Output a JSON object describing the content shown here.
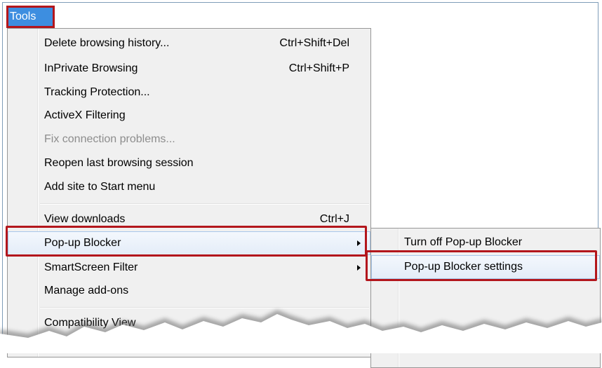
{
  "menubar": {
    "tools_label": "Tools"
  },
  "tools_menu": {
    "items": [
      {
        "label": "Delete browsing history...",
        "shortcut": "Ctrl+Shift+Del"
      },
      {
        "label": "InPrivate Browsing",
        "shortcut": "Ctrl+Shift+P"
      },
      {
        "label": "Tracking Protection..."
      },
      {
        "label": "ActiveX Filtering"
      },
      {
        "label": "Fix connection problems...",
        "disabled": true
      },
      {
        "label": "Reopen last browsing session"
      },
      {
        "label": "Add site to Start menu"
      },
      {
        "label": "View downloads",
        "shortcut": "Ctrl+J"
      },
      {
        "label": "Pop-up Blocker",
        "submenu": true,
        "highlighted": true
      },
      {
        "label": "SmartScreen Filter",
        "submenu": true
      },
      {
        "label": "Manage add-ons"
      },
      {
        "label": "Compatibility View"
      }
    ]
  },
  "popup_submenu": {
    "items": [
      {
        "label": "Turn off Pop-up Blocker"
      },
      {
        "label": "Pop-up Blocker settings",
        "highlighted": true
      }
    ]
  },
  "colors": {
    "annotation_red": "#b3161c",
    "menu_bg": "#f0f0f0",
    "tools_tab_bg": "#3d8ee0",
    "highlight": "#e3ecf8"
  }
}
